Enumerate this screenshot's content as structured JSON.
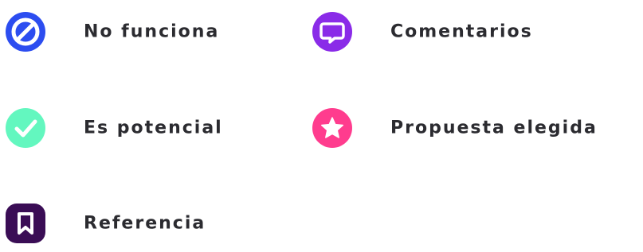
{
  "legend": {
    "items": [
      {
        "label": "No funciona",
        "icon": "block-icon",
        "color": "#2c4df0"
      },
      {
        "label": "Comentarios",
        "icon": "comment-icon",
        "color": "#8a2be8"
      },
      {
        "label": "Es potencial",
        "icon": "check-icon",
        "color": "#63f7bf"
      },
      {
        "label": "Propuesta elegida",
        "icon": "star-icon",
        "color": "#ff3c8e"
      },
      {
        "label": "Referencia",
        "icon": "bookmark-icon",
        "color": "#3a0d55"
      }
    ]
  }
}
